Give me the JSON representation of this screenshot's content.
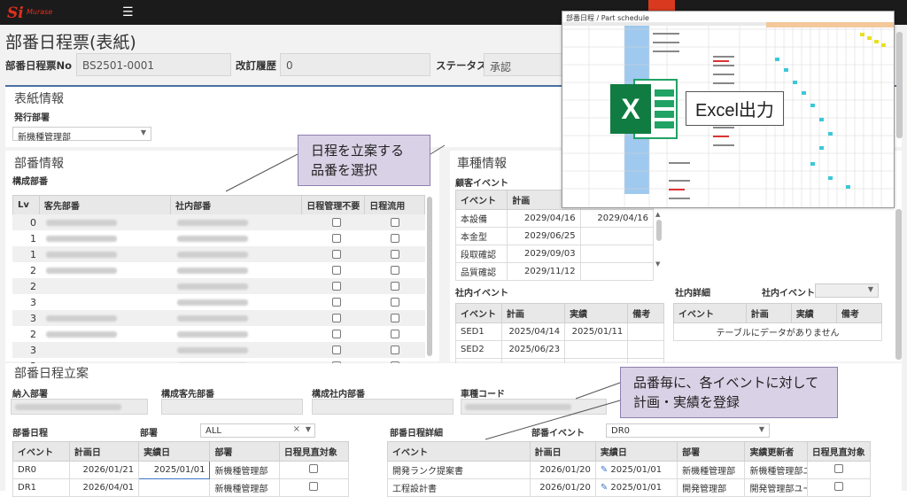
{
  "app": {
    "logo": "Murase"
  },
  "header": {
    "title": "部番日程票(表紙)"
  },
  "fields": {
    "part_no_label": "部番日程票No",
    "part_no_value": "BS2501-0001",
    "rev_label": "改訂履歴",
    "rev_value": "0",
    "status_label": "ステータス",
    "status_value": "承認"
  },
  "cover": {
    "title": "表紙情報",
    "dept_label": "発行部署",
    "dept_value": "新機種管理部"
  },
  "part": {
    "title": "部番情報",
    "sub": "構成部番",
    "headers": [
      "Lv",
      "客先部番",
      "社内部番",
      "日程管理不要",
      "日程流用"
    ],
    "levels": [
      "0",
      "1",
      "1",
      "2",
      "2",
      "3",
      "3",
      "2",
      "3",
      "3"
    ]
  },
  "vehicle": {
    "title": "車種情報",
    "customer_events_label": "顧客イベント",
    "headers": [
      "イベント",
      "計画",
      ""
    ],
    "rows": [
      [
        "本設備",
        "2029/04/16",
        "2029/04/16"
      ],
      [
        "本金型",
        "2029/06/25",
        ""
      ],
      [
        "段取確認",
        "2029/09/03",
        ""
      ],
      [
        "品質確認",
        "2029/11/12",
        ""
      ]
    ],
    "internal_events_label": "社内イベント",
    "internal_headers": [
      "イベント",
      "計画",
      "実績",
      "備考"
    ],
    "internal_rows": [
      [
        "SED1",
        "2025/04/14",
        "2025/01/11",
        ""
      ],
      [
        "SED2",
        "2025/06/23",
        "",
        ""
      ],
      [
        "SED3",
        "2025/08/31",
        "",
        ""
      ]
    ],
    "internal_detail_label": "社内詳細",
    "internal_event_select_label": "社内イベント",
    "detail_headers": [
      "イベント",
      "計画",
      "実績",
      "備考"
    ],
    "detail_empty": "テーブルにデータがありません"
  },
  "plan": {
    "title": "部番日程立案",
    "delivery_label": "納入部署",
    "cust_dept_label": "構成客先部番",
    "int_dept_label": "構成社内部番",
    "vehicle_code_label": "車種コード",
    "schedule_label": "部番日程",
    "dept_label": "部署",
    "dept_select": "ALL",
    "headers": [
      "イベント",
      "計画日",
      "実績日",
      "部署",
      "日程見直対象"
    ],
    "rows": [
      [
        "DR0",
        "2026/01/21",
        "2025/01/01",
        "新機種管理部"
      ],
      [
        "DR1",
        "2026/04/01",
        "",
        "新機種管理部"
      ]
    ],
    "detail_label": "部番日程詳細",
    "event_select_label": "部番イベント",
    "event_select": "DR0",
    "detail_headers": [
      "イベント",
      "計画日",
      "実績日",
      "部署",
      "実績更新者",
      "日程見直対象"
    ],
    "detail_rows": [
      [
        "開発ランク提案書",
        "2026/01/20",
        "2025/01/01",
        "新機種管理部",
        "新機種管理部ユーザ"
      ],
      [
        "工程設計書",
        "2026/01/20",
        "2025/01/01",
        "開発管理部",
        "開発管理部ユーザ"
      ]
    ]
  },
  "excel": {
    "window_title": "部番日程 / Part schedule",
    "label": "Excel出力",
    "icon_letter": "X"
  },
  "callouts": {
    "c1_line1": "日程を立案する",
    "c1_line2": "品番を選択",
    "c2_line1": "品番毎に、各イベントに対して",
    "c2_line2": "計画・実績を登録"
  }
}
